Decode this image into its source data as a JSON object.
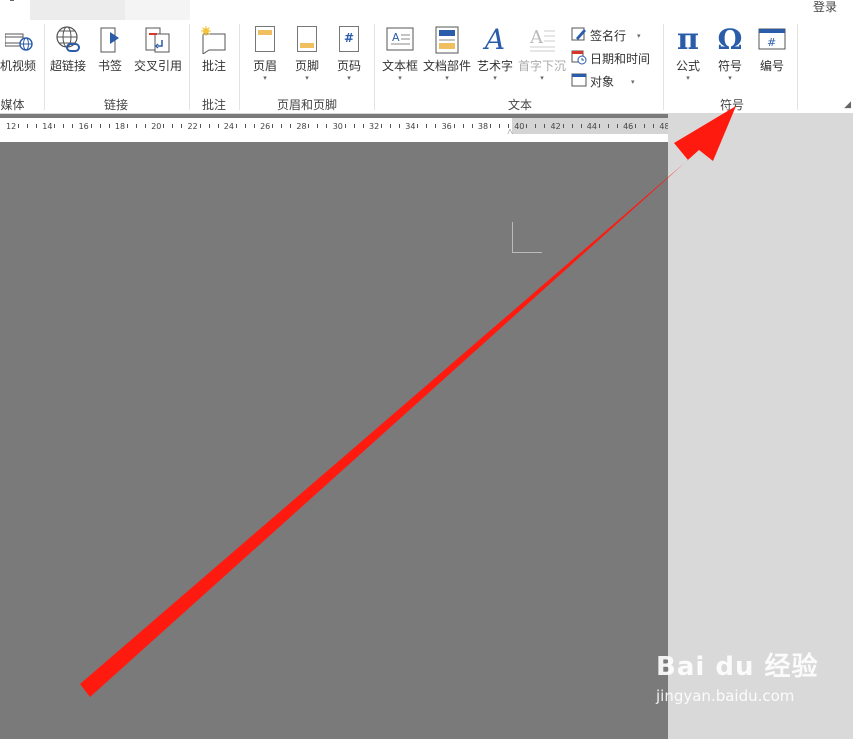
{
  "window": {
    "login_label": "登录"
  },
  "ribbon": {
    "groups": {
      "media": "媒体",
      "links": "链接",
      "comments": "批注",
      "header_footer": "页眉和页脚",
      "text": "文本",
      "symbols": "符号"
    },
    "buttons": {
      "online_video": "机视频",
      "hyperlink": "超链接",
      "bookmark": "书签",
      "cross_reference": "交叉引用",
      "comment": "批注",
      "header": "页眉",
      "footer": "页脚",
      "page_number": "页码",
      "text_box": "文本框",
      "quick_parts": "文档部件",
      "word_art": "艺术字",
      "drop_cap": "首字下沉",
      "signature_line": "签名行",
      "date_time": "日期和时间",
      "object": "对象",
      "equation": "公式",
      "symbol": "符号",
      "numbering": "编号"
    },
    "dropdown_glyph": "▾",
    "glyphs": {
      "pi": "π",
      "omega": "Ω",
      "hash": "#",
      "word_art": "A"
    }
  },
  "ruler": {
    "ticks": [
      "12",
      "14",
      "16",
      "18",
      "20",
      "22",
      "24",
      "26",
      "28",
      "30",
      "32",
      "34",
      "36",
      "38",
      "40",
      "42",
      "44",
      "46",
      "48"
    ]
  },
  "watermark": {
    "line1": "Bai du 经验",
    "line2": "jingyan.baidu.com"
  },
  "colors": {
    "arrow": "#ff1a10",
    "ribbon_bg": "#ffffff",
    "canvas": "#7a7a7a",
    "accent_blue": "#2a5caa"
  }
}
